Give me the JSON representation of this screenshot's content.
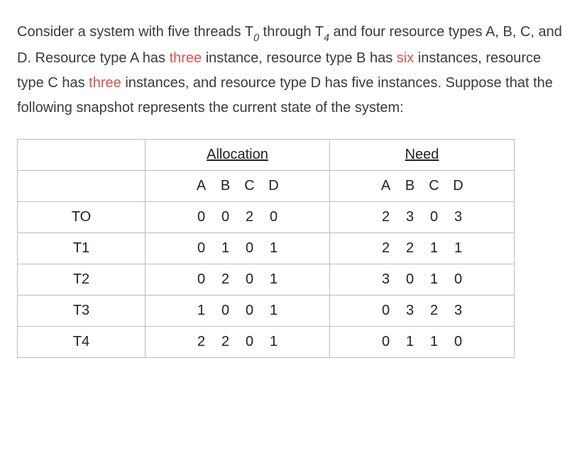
{
  "paragraph": {
    "p1": "Consider a system with five threads T",
    "sub0": "0",
    "p2": " through T",
    "sub4": "4",
    "p3": " and four resource types A, B, C, and D. Resource type A has ",
    "h1": "three",
    "p4": " instance, resource type B has ",
    "h2": "six",
    "p5": " instances, resource type C has ",
    "h3": "three",
    "p6": " instances, and resource type D has five instances. Suppose that the following snapshot represents the current state of the system:"
  },
  "headers": {
    "allocation": "Allocation",
    "need": "Need"
  },
  "cols": {
    "a": "A",
    "b": "B",
    "c": "C",
    "d": "D"
  },
  "rows": [
    {
      "thread": "TO",
      "alloc": [
        "0",
        "0",
        "2",
        "0"
      ],
      "need": [
        "2",
        "3",
        "0",
        "3"
      ]
    },
    {
      "thread": "T1",
      "alloc": [
        "0",
        "1",
        "0",
        "1"
      ],
      "need": [
        "2",
        "2",
        "1",
        "1"
      ]
    },
    {
      "thread": "T2",
      "alloc": [
        "0",
        "2",
        "0",
        "1"
      ],
      "need": [
        "3",
        "0",
        "1",
        "0"
      ]
    },
    {
      "thread": "T3",
      "alloc": [
        "1",
        "0",
        "0",
        "1"
      ],
      "need": [
        "0",
        "3",
        "2",
        "3"
      ]
    },
    {
      "thread": "T4",
      "alloc": [
        "2",
        "2",
        "0",
        "1"
      ],
      "need": [
        "0",
        "1",
        "1",
        "0"
      ]
    }
  ]
}
